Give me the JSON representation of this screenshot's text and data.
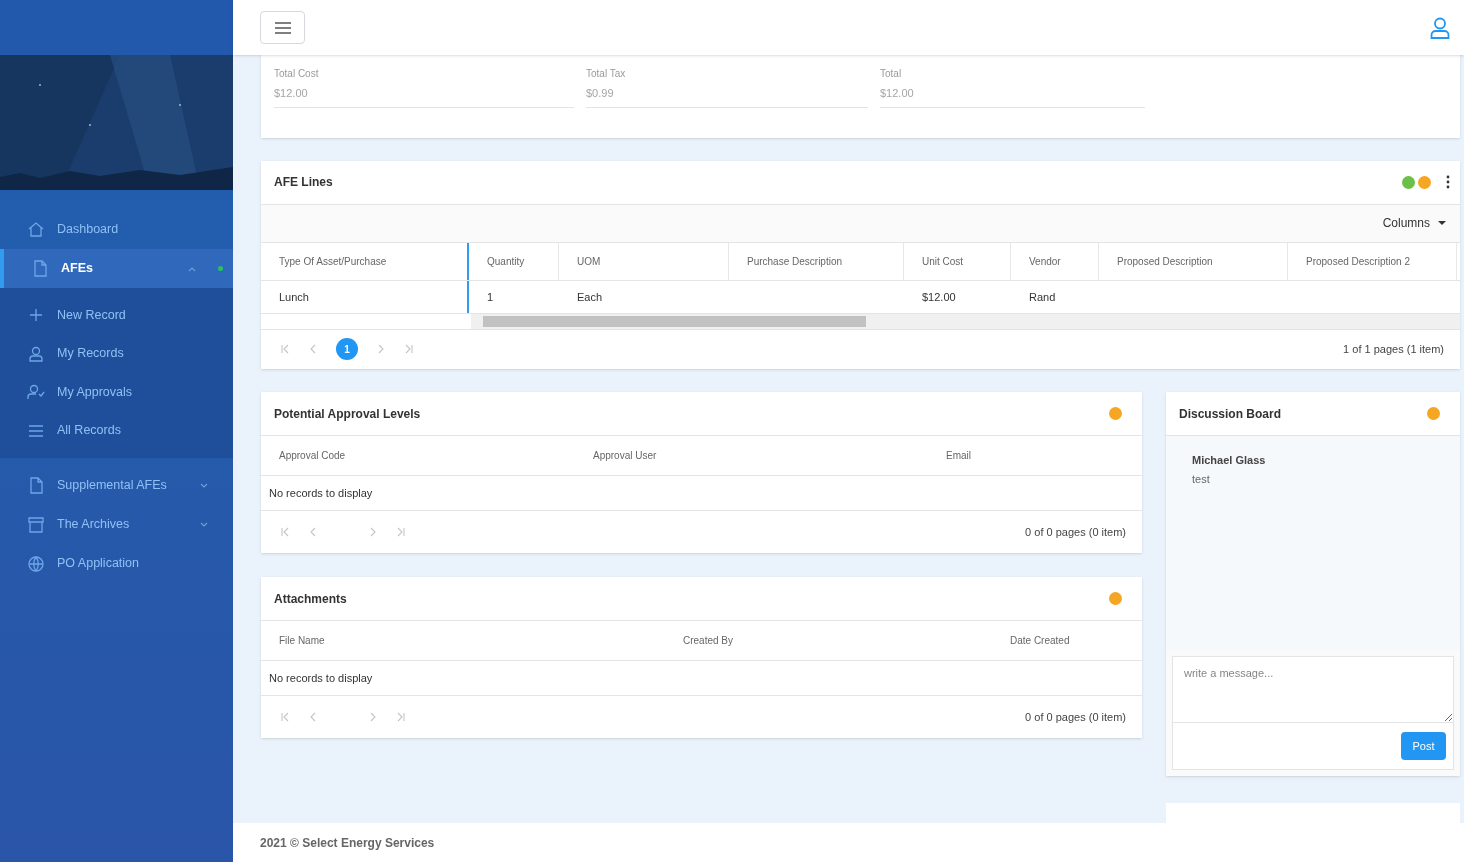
{
  "sidebar": {
    "items": [
      {
        "label": "Dashboard",
        "selected": false
      },
      {
        "label": "AFEs",
        "selected": true,
        "expanded": true,
        "children": [
          {
            "label": "New Record"
          },
          {
            "label": "My Records"
          },
          {
            "label": "My Approvals"
          },
          {
            "label": "All Records"
          }
        ]
      },
      {
        "label": "Supplemental AFEs",
        "selected": false,
        "expanded": false
      },
      {
        "label": "The Archives",
        "selected": false,
        "expanded": false
      },
      {
        "label": "PO Application",
        "selected": false
      }
    ]
  },
  "totals": {
    "fields": [
      {
        "label": "Total Cost",
        "value": "$12.00"
      },
      {
        "label": "Total Tax",
        "value": "$0.99"
      },
      {
        "label": "Total",
        "value": "$12.00"
      }
    ]
  },
  "afe_lines": {
    "title": "AFE Lines",
    "dots": [
      {
        "color": "#6cc04a"
      },
      {
        "color": "#f5a623"
      }
    ],
    "columns_button": "Columns",
    "columns": [
      "Type Of Asset/Purchase",
      "Quantity",
      "UOM",
      "Purchase Description",
      "Unit Cost",
      "Vendor",
      "Proposed Description",
      "Proposed Description 2"
    ],
    "rows": [
      [
        "Lunch",
        "1",
        "Each",
        "",
        "$12.00",
        "Rand",
        "",
        ""
      ]
    ],
    "pages": [
      {
        "label": "1",
        "selected": true
      }
    ],
    "pager_info": "1 of 1 pages (1 item)"
  },
  "approval_levels": {
    "title": "Potential Approval Levels",
    "dots": [
      {
        "color": "#f5a623"
      }
    ],
    "columns": [
      "Approval Code",
      "Approval User",
      "Email"
    ],
    "empty": "No records to display",
    "pager_info": "0 of 0 pages (0 item)"
  },
  "attachments": {
    "title": "Attachments",
    "dots": [
      {
        "color": "#f5a623"
      }
    ],
    "columns": [
      "File Name",
      "Created By",
      "Date Created"
    ],
    "empty": "No records to display",
    "pager_info": "0 of 0 pages (0 item)"
  },
  "discussion": {
    "title": "Discussion Board",
    "dots": [
      {
        "color": "#f5a623"
      }
    ],
    "messages": [
      {
        "author": "Michael Glass",
        "text": "test"
      }
    ],
    "placeholder": "write a message...",
    "post_button": "Post"
  },
  "footer": "2021 © Select Energy Services"
}
